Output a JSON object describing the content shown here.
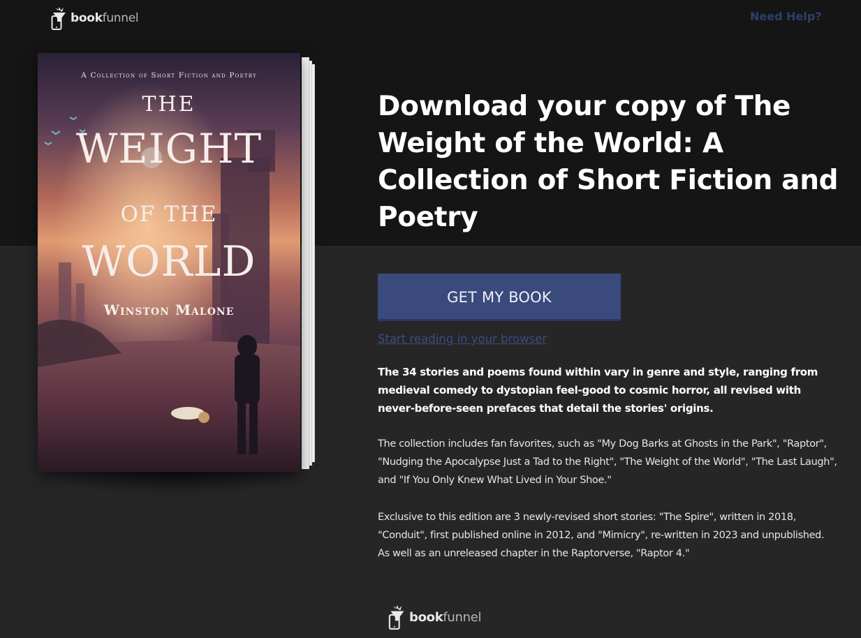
{
  "header": {
    "logo_bold": "book",
    "logo_light": "funnel",
    "help_link": "Need Help?"
  },
  "book": {
    "cover_tagline": "A Collection of Short Fiction and Poetry",
    "cover_title_1": "THE",
    "cover_title_2": "WEIGHT",
    "cover_title_3": "OF THE",
    "cover_title_4": "WORLD",
    "cover_author": "Winston Malone"
  },
  "main": {
    "title": "Download your copy of The Weight of the World: A Collection of Short Fiction and Poetry",
    "cta_label": "GET MY BOOK",
    "browser_link": "Start reading in your browser",
    "description_bold": "The 34 stories and poems found within vary in genre and style, ranging from medieval comedy to dystopian feel-good to cosmic horror, all revised with never-before-seen prefaces that detail the stories' origins.",
    "description_1": "The collection includes fan favorites, such as \"My Dog Barks at Ghosts in the Park\", \"Raptor\", \"Nudging the Apocalypse Just a Tad to the Right\", \"The Weight of the World\", \"The Last Laugh\", and \"If You Only Knew What Lived in Your Shoe.\"",
    "description_2": "Exclusive to this edition are 3 newly-revised short stories: \"The Spire\", written in 2018, \"Conduit\", first published online in 2012, and \"Mimicry\", re-written in 2023 and unpublished. As well as an unreleased chapter in the Raptorverse, \"Raptor 4.\""
  },
  "footer": {
    "logo_bold": "book",
    "logo_light": "funnel"
  },
  "colors": {
    "top_band": "#151515",
    "bottom_band": "#262626",
    "accent": "#3a4a7c",
    "link": "#3b4d82"
  },
  "icons": {
    "logo": "bookfunnel-phone-funnel-icon"
  }
}
